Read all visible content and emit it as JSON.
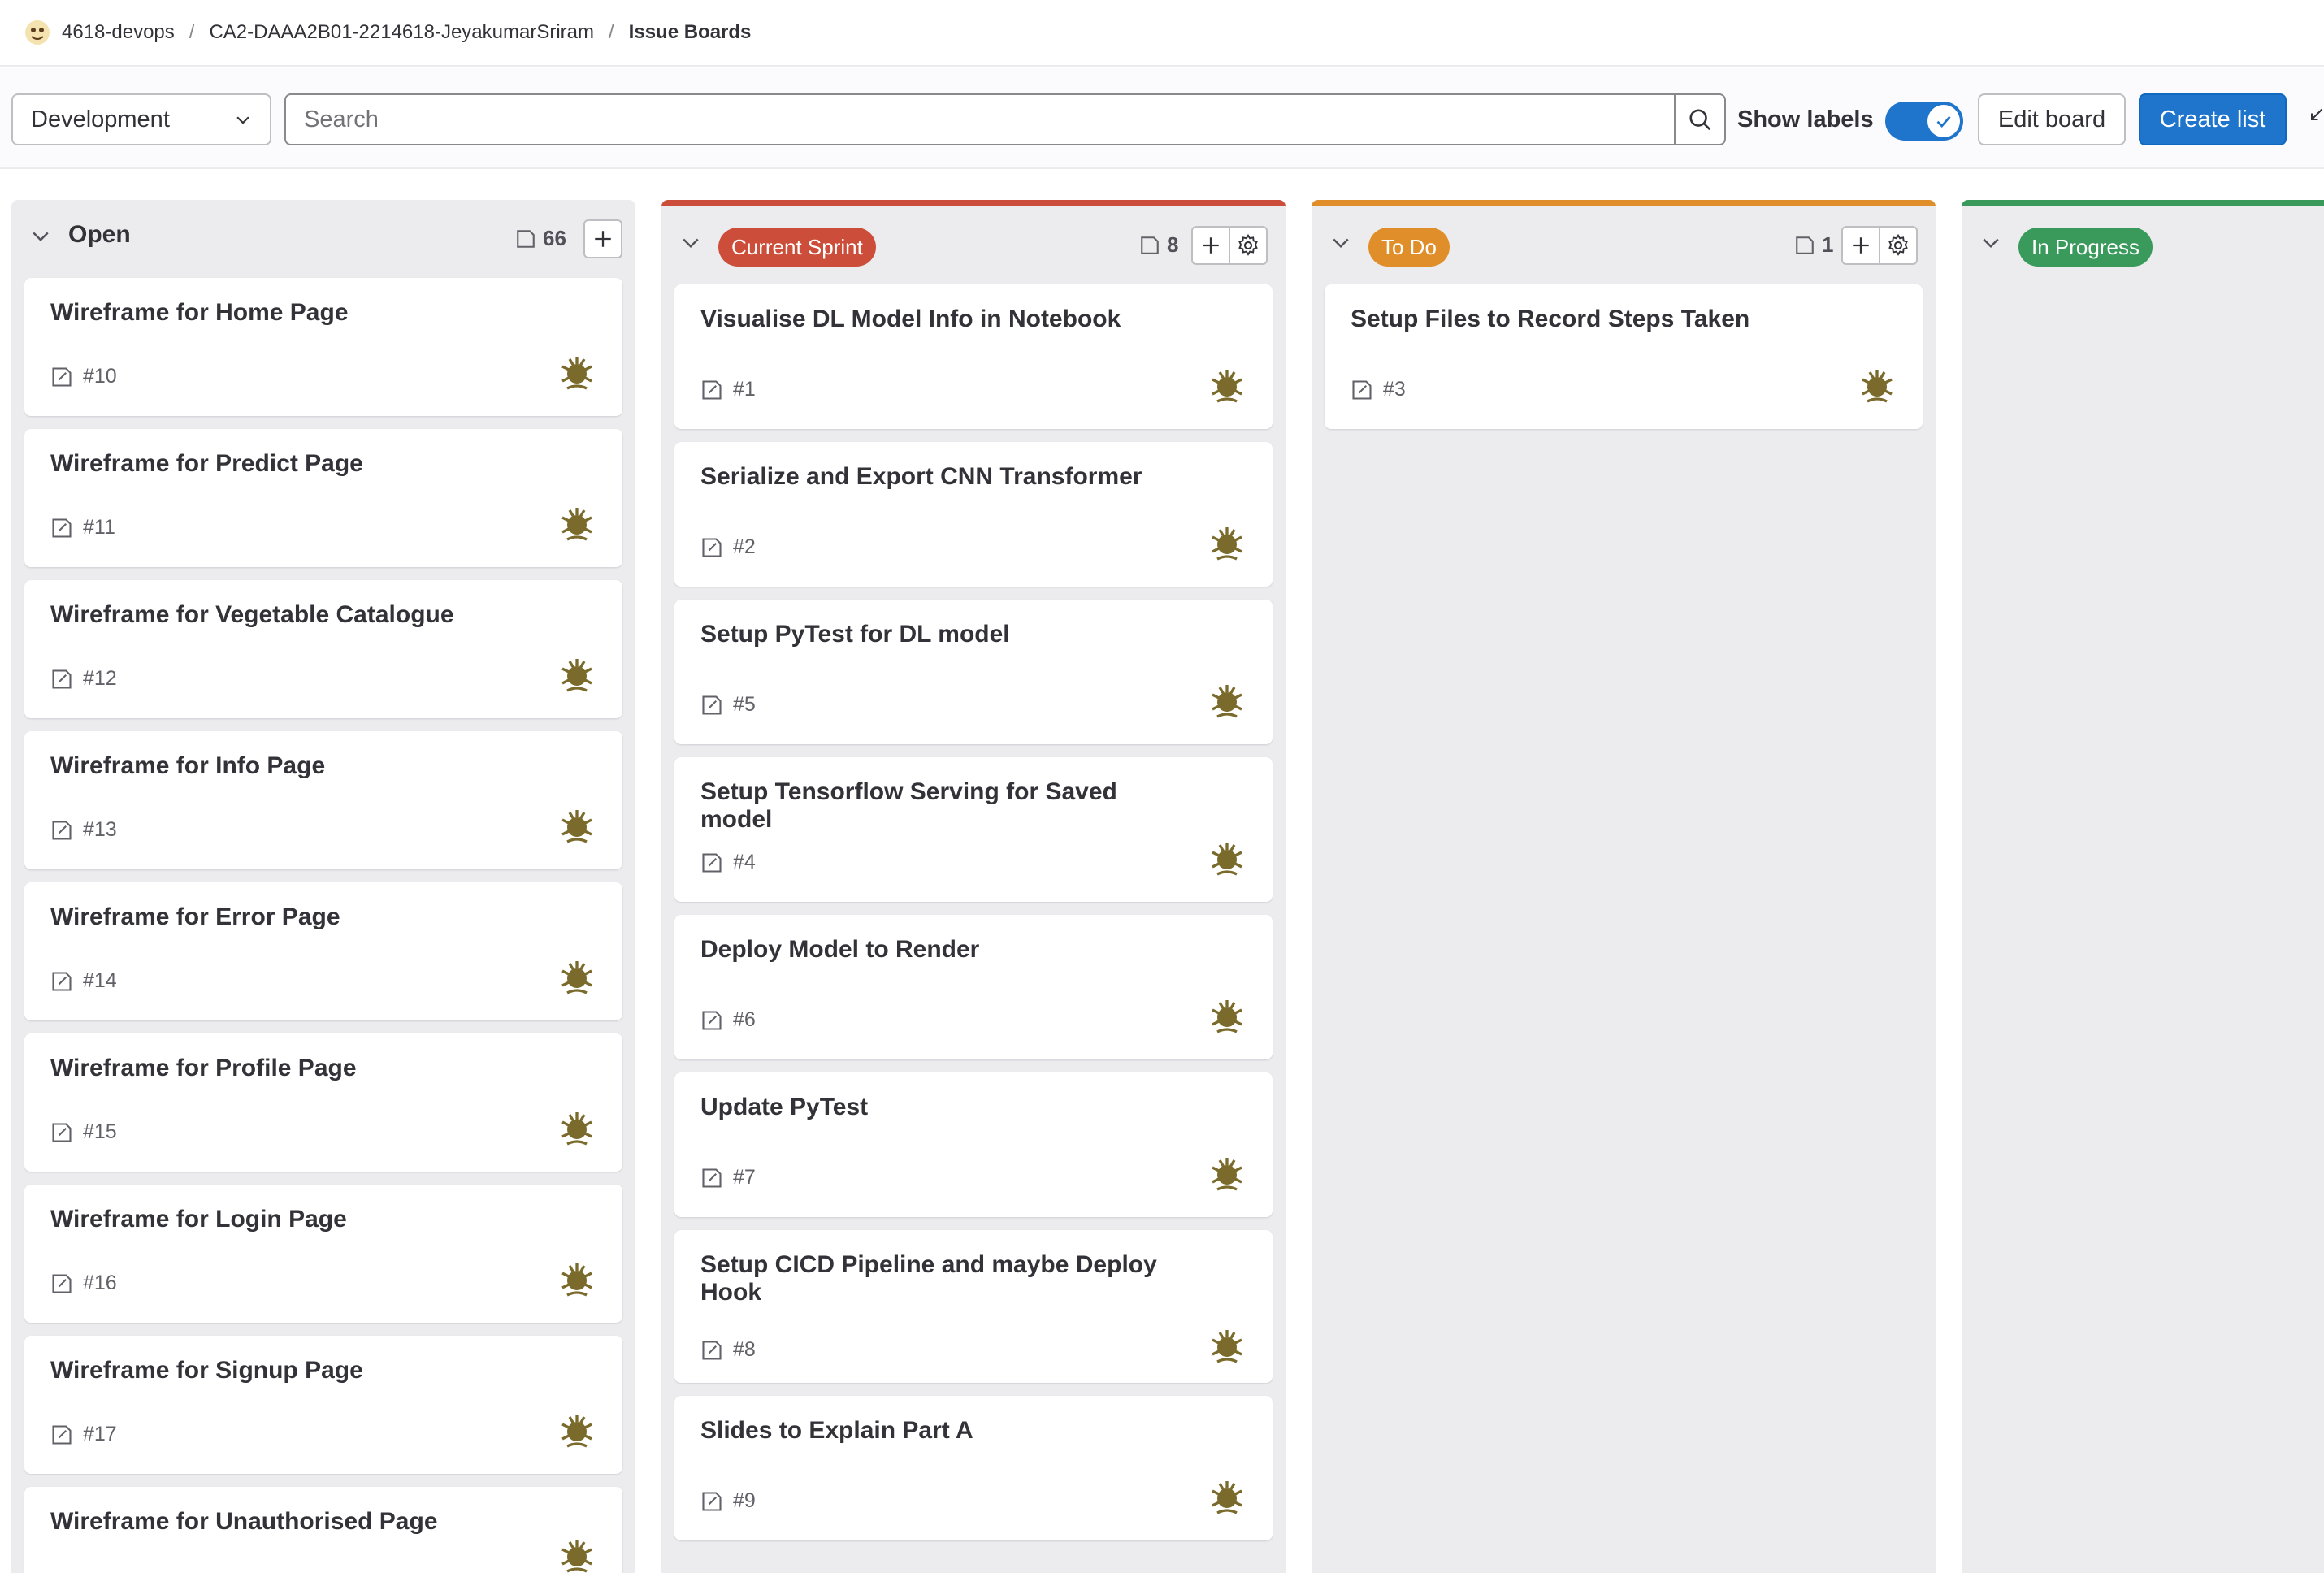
{
  "breadcrumb": {
    "group": "4618-devops",
    "project": "CA2-DAAA2B01-2214618-JeyakumarSriram",
    "current": "Issue Boards"
  },
  "toolbar": {
    "board_name": "Development",
    "search_placeholder": "Search",
    "show_labels_label": "Show labels",
    "show_labels_on": true,
    "edit_board_label": "Edit board",
    "create_list_label": "Create list"
  },
  "colors": {
    "current_sprint": "#cc4e3a",
    "to_do": "#e08e2a",
    "in_progress": "#3a9a5b",
    "primary": "#1f75cb"
  },
  "lists": [
    {
      "title": "Open",
      "count": "66",
      "cards": [
        {
          "title": "Wireframe for Home Page",
          "ref": "#10"
        },
        {
          "title": "Wireframe for Predict Page",
          "ref": "#11"
        },
        {
          "title": "Wireframe for Vegetable Catalogue",
          "ref": "#12"
        },
        {
          "title": "Wireframe for Info Page",
          "ref": "#13"
        },
        {
          "title": "Wireframe for Error Page",
          "ref": "#14"
        },
        {
          "title": "Wireframe for Profile Page",
          "ref": "#15"
        },
        {
          "title": "Wireframe for Login Page",
          "ref": "#16"
        },
        {
          "title": "Wireframe for Signup Page",
          "ref": "#17"
        },
        {
          "title": "Wireframe for Unauthorised Page",
          "ref": ""
        }
      ]
    },
    {
      "title": "Current Sprint",
      "count": "8",
      "cards": [
        {
          "title": "Visualise DL Model Info in Notebook",
          "ref": "#1"
        },
        {
          "title": "Serialize and Export CNN Transformer",
          "ref": "#2"
        },
        {
          "title": "Setup PyTest for DL model",
          "ref": "#5"
        },
        {
          "title": "Setup Tensorflow Serving for Saved model",
          "ref": "#4"
        },
        {
          "title": "Deploy Model to Render",
          "ref": "#6"
        },
        {
          "title": "Update PyTest",
          "ref": "#7"
        },
        {
          "title": "Setup CICD Pipeline and maybe Deploy Hook",
          "ref": "#8"
        },
        {
          "title": "Slides to Explain Part A",
          "ref": "#9"
        }
      ]
    },
    {
      "title": "To Do",
      "count": "1",
      "cards": [
        {
          "title": "Setup Files to Record Steps Taken",
          "ref": "#3"
        }
      ]
    },
    {
      "title": "In Progress",
      "count": "",
      "cards": []
    }
  ]
}
